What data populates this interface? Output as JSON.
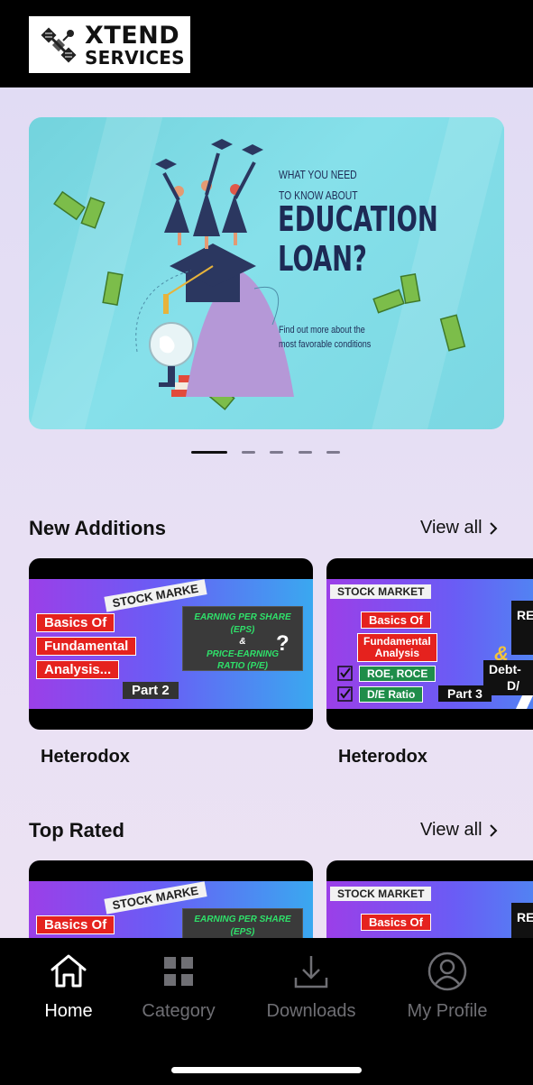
{
  "app": {
    "logo_line1": "XTEND",
    "logo_line2": "SERVICES"
  },
  "banner": {
    "line1": "WHAT YOU NEED",
    "line2": "TO KNOW ABOUT",
    "headline1": "EDUCATION",
    "headline2": "LOAN?",
    "sub1": "Find out more about the",
    "sub2": "most favorable conditions",
    "slide_count": 5,
    "active_slide": 1
  },
  "sections": {
    "new_additions": {
      "title": "New Additions",
      "view_all": "View all",
      "cards": [
        {
          "title": "Heterodox",
          "thumb": {
            "tag": "STOCK MARKE",
            "red_labels": [
              "Basics Of",
              "Fundamental",
              "Analysis..."
            ],
            "eps_line1": "EARNING PER SHARE (EPS)",
            "eps_amp": "&",
            "eps_line2": "PRICE-EARNING",
            "eps_line3": "RATIO (P/E)",
            "q": "?",
            "part": "Part 2"
          }
        },
        {
          "title": "Heterodox",
          "thumb": {
            "tag": "STOCK MARKET",
            "red_labels": [
              "Basics Of",
              "Fundamental",
              "Analysis"
            ],
            "green_labels": [
              "ROE, ROCE",
              "D/E Ratio"
            ],
            "part": "Part 3",
            "right1": "RE",
            "right2": "Debt-",
            "right3": "D/",
            "amp": "&"
          }
        }
      ]
    },
    "top_rated": {
      "title": "Top Rated",
      "view_all": "View all",
      "cards": [
        {
          "thumb": {
            "tag": "STOCK MARKE",
            "red_label": "Basics Of",
            "eps_line1": "EARNING PER SHARE (EPS)",
            "eps_amp": "&"
          }
        },
        {
          "thumb": {
            "tag": "STOCK MARKET",
            "red_label": "Basics Of",
            "right1": "RE"
          }
        }
      ]
    }
  },
  "nav": {
    "items": [
      {
        "label": "Home",
        "icon": "home-icon",
        "active": true
      },
      {
        "label": "Category",
        "icon": "grid-icon",
        "active": false
      },
      {
        "label": "Downloads",
        "icon": "download-icon",
        "active": false
      },
      {
        "label": "My Profile",
        "icon": "profile-icon",
        "active": false
      }
    ],
    "active_color": "#ffffff",
    "inactive_color": "#6f6f74"
  }
}
